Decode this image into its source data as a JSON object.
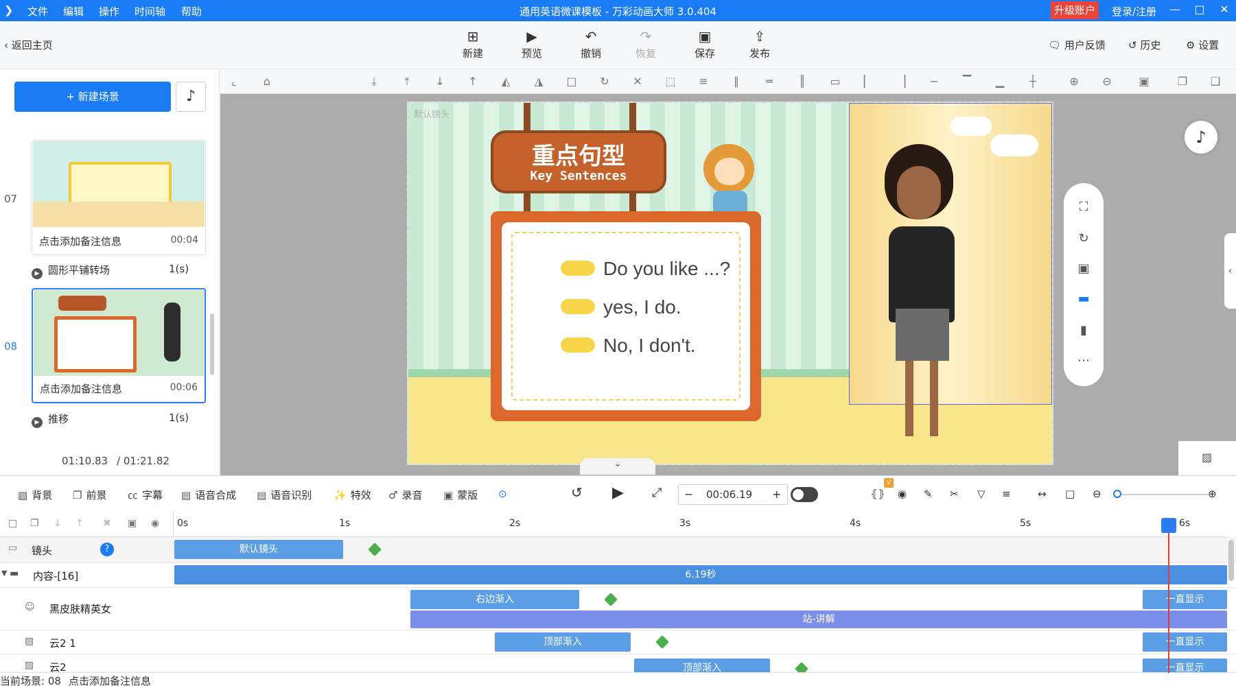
{
  "titlebar": {
    "menus": [
      "文件",
      "编辑",
      "操作",
      "时间轴",
      "帮助"
    ],
    "title": "通用英语微课模板 - 万彩动画大师 3.0.404",
    "upgrade": "升级账户",
    "login": "登录/注册"
  },
  "toolbar": {
    "back": "返回主页",
    "buttons": [
      "新建",
      "预览",
      "撤销",
      "恢复",
      "保存",
      "发布"
    ],
    "feedback": "用户反馈",
    "history": "历史",
    "settings": "设置"
  },
  "left": {
    "new_scene": "新建场景",
    "scenes": [
      {
        "num": "07",
        "note": "点击添加备注信息",
        "time": "00:04"
      },
      {
        "num": "08",
        "note": "点击添加备注信息",
        "time": "00:06"
      }
    ],
    "transitions": [
      {
        "name": "圆形平铺转场",
        "dur": "1(s)"
      },
      {
        "name": "推移",
        "dur": "1(s)"
      }
    ],
    "current_time": "01:10.83",
    "total_time": "/ 01:21.82"
  },
  "stage": {
    "camera_label": "默认镜头",
    "sign_cn": "重点句型",
    "sign_en": "Key Sentences",
    "sentences": [
      "Do you like ...?",
      "yes, I do.",
      "No, I don't."
    ]
  },
  "controls": {
    "items": [
      "背景",
      "前景",
      "字幕",
      "语音合成",
      "语音识别",
      "特效",
      "录音",
      "蒙版"
    ],
    "time": "00:06.19"
  },
  "timeline": {
    "ruler": [
      "0s",
      "1s",
      "2s",
      "3s",
      "4s",
      "5s",
      "6s"
    ],
    "tracks": [
      {
        "name": "镜头",
        "clips": [
          "默认镜头"
        ]
      },
      {
        "name": "内容-[16]",
        "clips": [
          "6.19秒"
        ]
      },
      {
        "name": "黑皮肤精英女",
        "clips": [
          "右边渐入",
          "一直显示",
          "站-讲解"
        ]
      },
      {
        "name": "云2 1",
        "clips": [
          "顶部渐入",
          "一直显示"
        ]
      },
      {
        "name": "云2",
        "clips": [
          "顶部渐入",
          "一直显示"
        ]
      }
    ]
  },
  "status": {
    "scene": "当前场景: 08",
    "note": "点击添加备注信息"
  },
  "colors": {
    "primary": "#1a7cf4",
    "clip": "#5b9ee6",
    "clip_purple": "#7b8ee8",
    "keyframe": "#4cae4c"
  }
}
